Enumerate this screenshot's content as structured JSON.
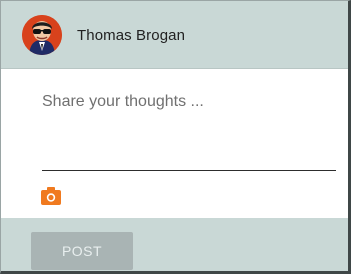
{
  "user": {
    "name": "Thomas Brogan",
    "avatar_icon": "avatar-icon"
  },
  "composer": {
    "placeholder": "Share your thoughts ...",
    "value": "",
    "camera_icon": "camera-icon"
  },
  "footer": {
    "post_label": "POST"
  },
  "colors": {
    "header_bg": "#c9d8d6",
    "footer_bg": "#c9d8d6",
    "camera_accent": "#f07a1f",
    "button_bg": "#a9b4b4",
    "button_text": "#e9efef"
  }
}
